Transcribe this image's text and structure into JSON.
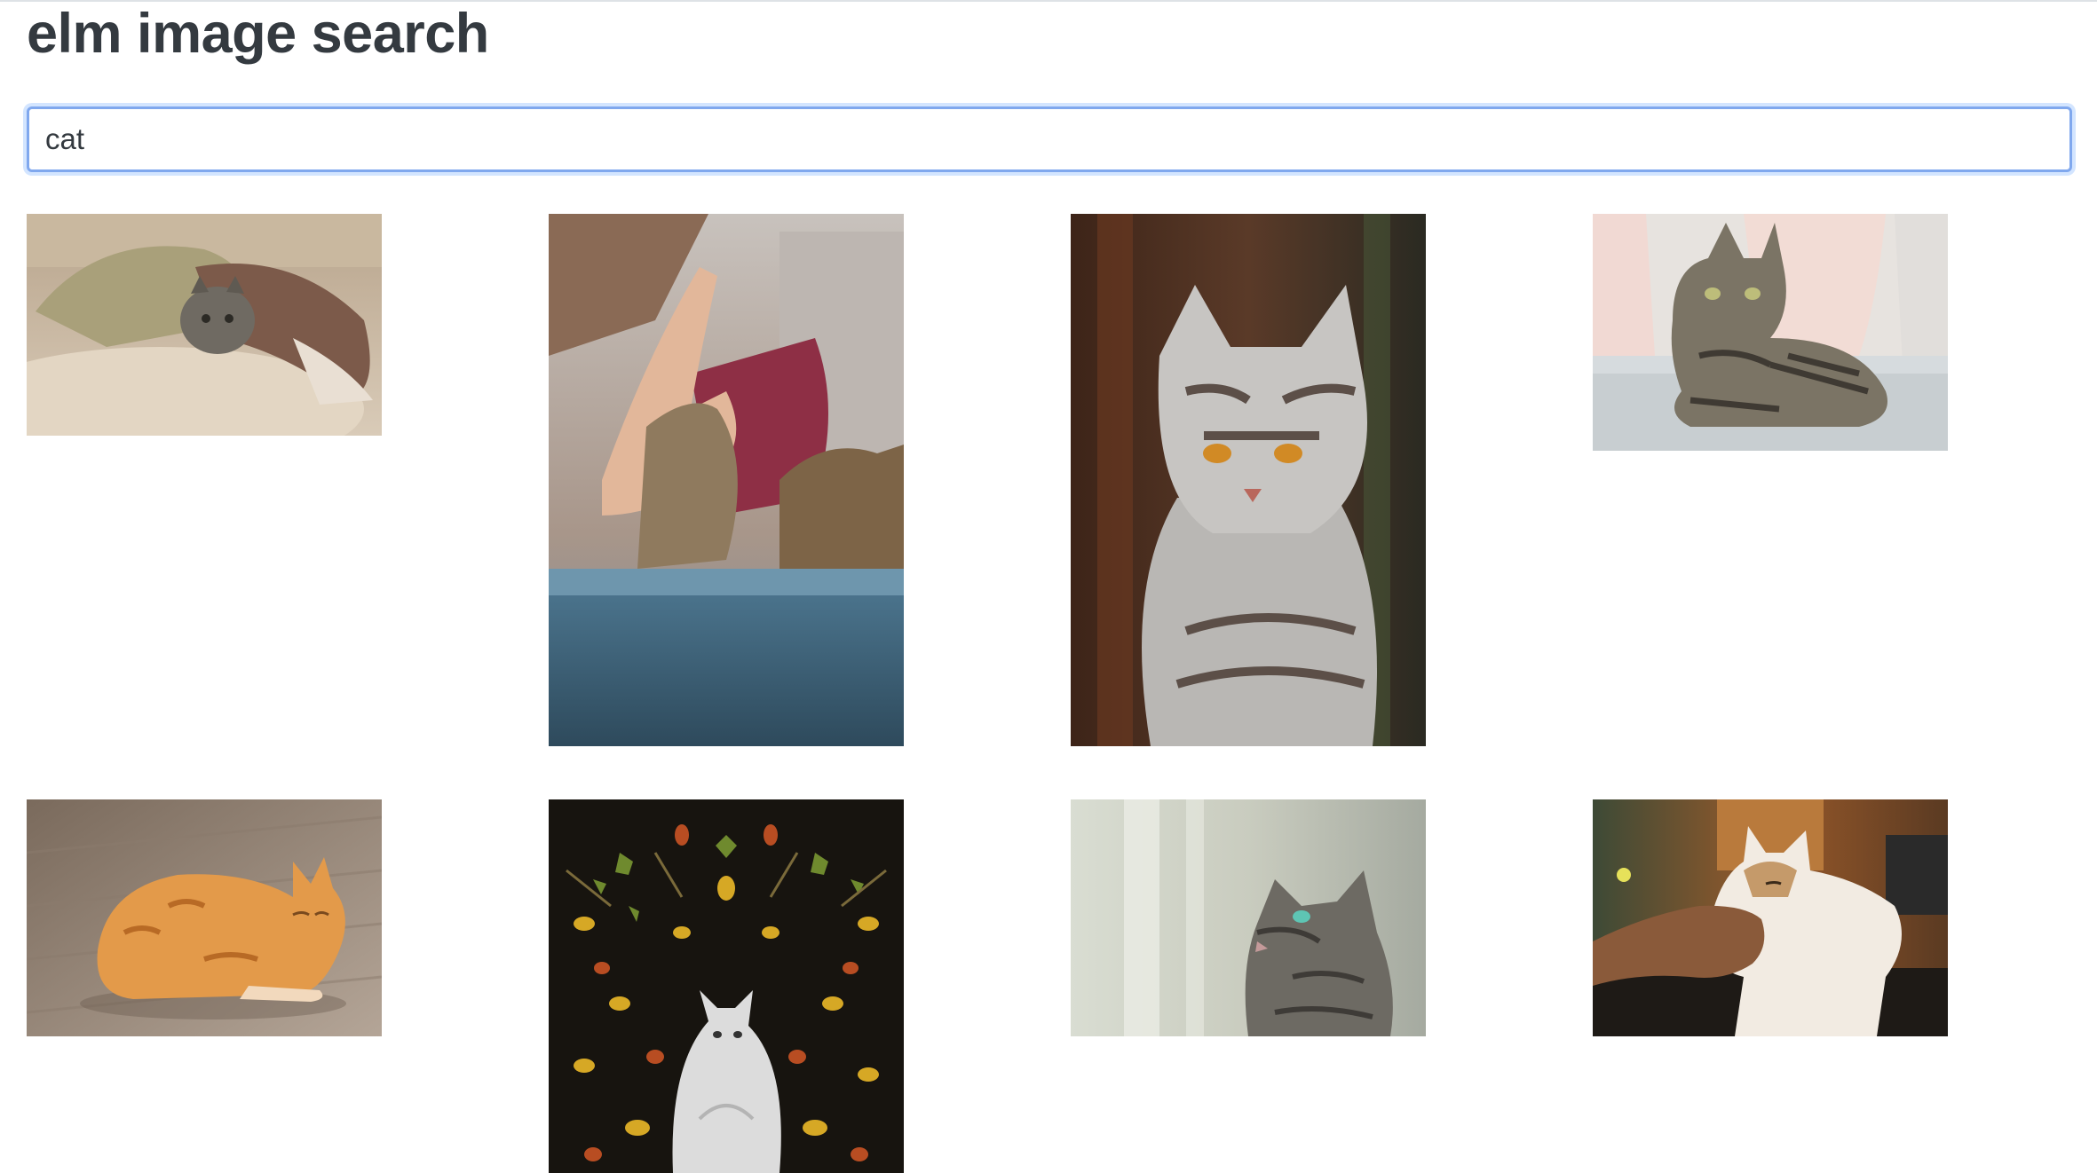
{
  "header": {
    "title": "elm image search"
  },
  "search": {
    "value": "cat"
  },
  "results": [
    {
      "subject": "tabby kitten under knitted blanket"
    },
    {
      "subject": "hand high-five with cat paw"
    },
    {
      "subject": "silver tabby cat portrait"
    },
    {
      "subject": "tabby cat lying on sofa"
    },
    {
      "subject": "orange cat lying on wooden floor"
    },
    {
      "subject": "white kitten among autumn leaves"
    },
    {
      "subject": "tabby cat looking up by window"
    },
    {
      "subject": "hand petting calico cat"
    }
  ]
}
